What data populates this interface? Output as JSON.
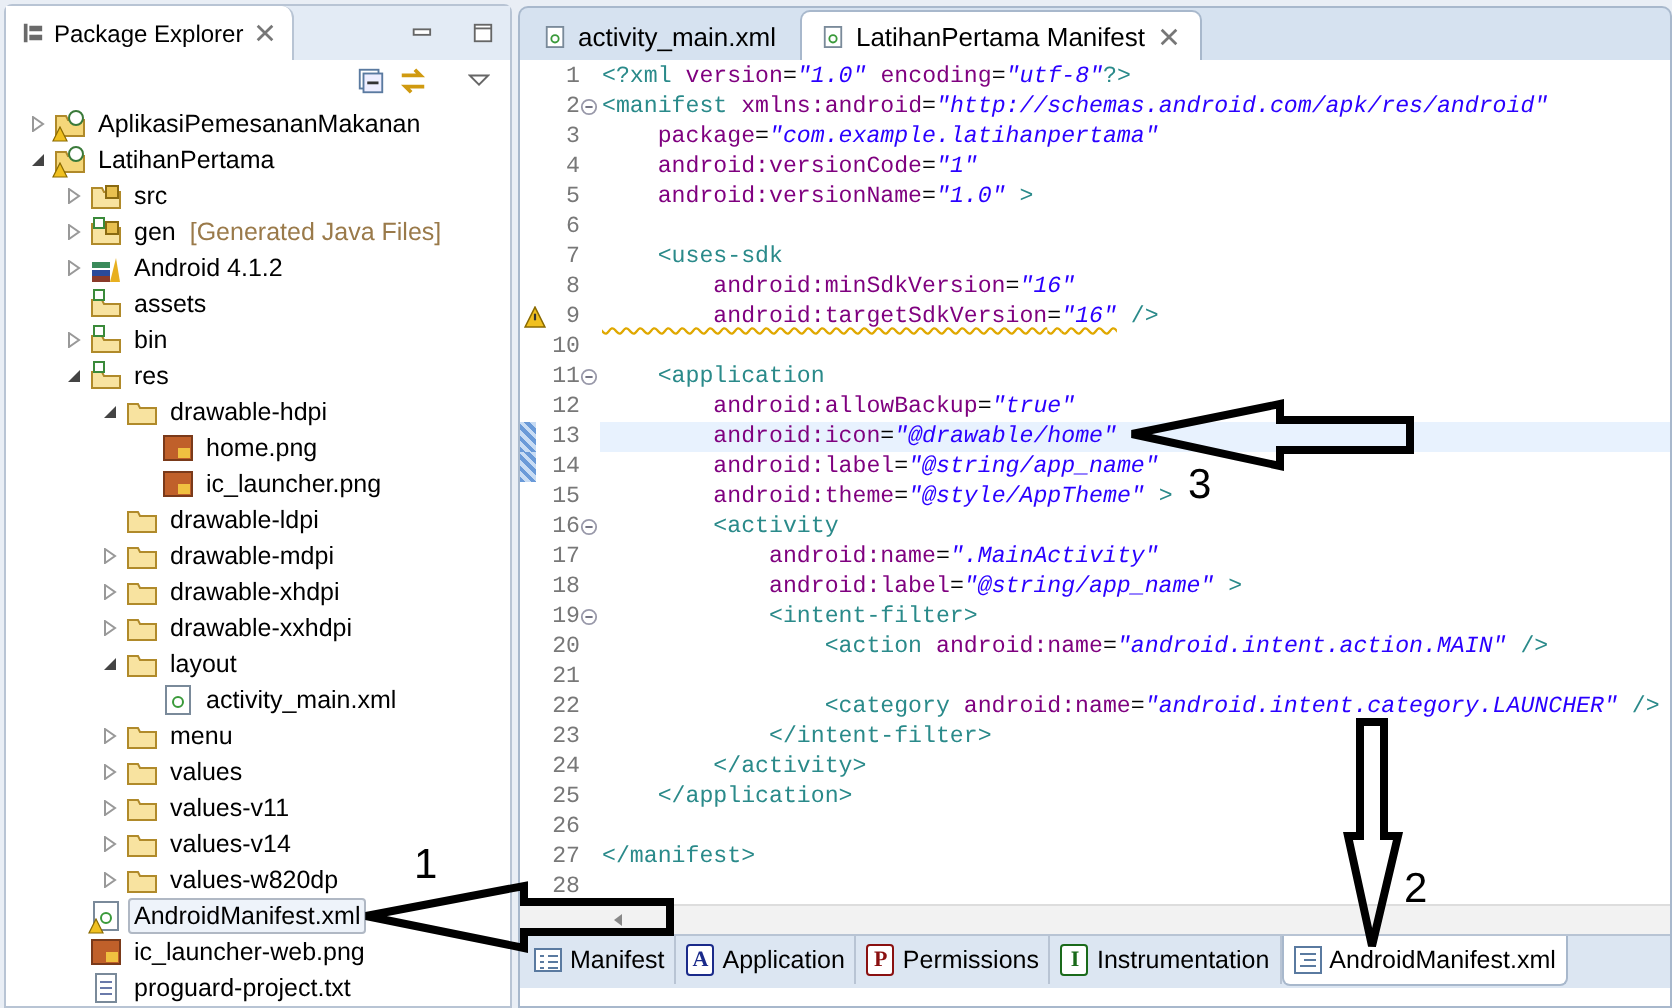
{
  "package_explorer": {
    "title": "Package Explorer",
    "tree": [
      {
        "label": "AplikasiPemesananMakanan",
        "kind": "project",
        "expanded": false,
        "warning": true,
        "selected": false
      },
      {
        "label": "LatihanPertama",
        "kind": "project",
        "expanded": true,
        "warning": true,
        "selected": false,
        "children": [
          {
            "label": "src",
            "kind": "package-folder",
            "expanded": false,
            "selected": false
          },
          {
            "label": "gen",
            "decoration": "[Generated Java Files]",
            "kind": "gen-folder",
            "expanded": false,
            "selected": false
          },
          {
            "label": "Android 4.1.2",
            "kind": "library",
            "expanded": false,
            "selected": false
          },
          {
            "label": "assets",
            "kind": "source-folder",
            "selected": false
          },
          {
            "label": "bin",
            "kind": "source-folder",
            "expanded": false,
            "selected": false
          },
          {
            "label": "res",
            "kind": "source-folder",
            "expanded": true,
            "selected": false,
            "children": [
              {
                "label": "drawable-hdpi",
                "kind": "folder",
                "expanded": true,
                "selected": false,
                "children": [
                  {
                    "label": "home.png",
                    "kind": "image",
                    "selected": false
                  },
                  {
                    "label": "ic_launcher.png",
                    "kind": "image",
                    "selected": false
                  }
                ]
              },
              {
                "label": "drawable-ldpi",
                "kind": "folder",
                "selected": false
              },
              {
                "label": "drawable-mdpi",
                "kind": "folder",
                "expanded": false,
                "selected": false
              },
              {
                "label": "drawable-xhdpi",
                "kind": "folder",
                "expanded": false,
                "selected": false
              },
              {
                "label": "drawable-xxhdpi",
                "kind": "folder",
                "expanded": false,
                "selected": false
              },
              {
                "label": "layout",
                "kind": "folder",
                "expanded": true,
                "selected": false,
                "children": [
                  {
                    "label": "activity_main.xml",
                    "kind": "xml",
                    "selected": false
                  }
                ]
              },
              {
                "label": "menu",
                "kind": "folder",
                "expanded": false,
                "selected": false
              },
              {
                "label": "values",
                "kind": "folder",
                "expanded": false,
                "selected": false
              },
              {
                "label": "values-v11",
                "kind": "folder",
                "expanded": false,
                "selected": false
              },
              {
                "label": "values-v14",
                "kind": "folder",
                "expanded": false,
                "selected": false
              },
              {
                "label": "values-w820dp",
                "kind": "folder",
                "expanded": false,
                "selected": false
              }
            ]
          },
          {
            "label": "AndroidManifest.xml",
            "kind": "xml",
            "warning": true,
            "selected": true
          },
          {
            "label": "ic_launcher-web.png",
            "kind": "image",
            "selected": false
          },
          {
            "label": "proguard-project.txt",
            "kind": "text",
            "selected": false
          }
        ]
      }
    ]
  },
  "editor": {
    "tabs": [
      {
        "label": "activity_main.xml",
        "selected": false
      },
      {
        "label": "LatihanPertama Manifest",
        "selected": true
      }
    ],
    "lines": [
      {
        "number": "1",
        "tokens": [
          {
            "kind": "tag",
            "text": "<?xml"
          },
          {
            "kind": "attr",
            "text": " version"
          },
          {
            "kind": "eq",
            "text": "="
          },
          {
            "kind": "value",
            "text": "\"1.0\""
          },
          {
            "kind": "attr",
            "text": " encoding"
          },
          {
            "kind": "eq",
            "text": "="
          },
          {
            "kind": "value",
            "text": "\"utf-8\""
          },
          {
            "kind": "tag",
            "text": "?>"
          }
        ]
      },
      {
        "number": "2",
        "fold": true,
        "tokens": [
          {
            "kind": "tag",
            "text": "<manifest"
          },
          {
            "kind": "attr",
            "text": " xmlns:android"
          },
          {
            "kind": "eq",
            "text": "="
          },
          {
            "kind": "value",
            "text": "\"http://schemas.android.com/apk/res/android\""
          }
        ]
      },
      {
        "number": "3",
        "tokens": [
          {
            "kind": "attr",
            "text": "    package"
          },
          {
            "kind": "eq",
            "text": "="
          },
          {
            "kind": "value",
            "text": "\"com.example.latihanpertama\""
          }
        ]
      },
      {
        "number": "4",
        "tokens": [
          {
            "kind": "attr",
            "text": "    android:versionCode"
          },
          {
            "kind": "eq",
            "text": "="
          },
          {
            "kind": "value",
            "text": "\"1\""
          }
        ]
      },
      {
        "number": "5",
        "tokens": [
          {
            "kind": "attr",
            "text": "    android:versionName"
          },
          {
            "kind": "eq",
            "text": "="
          },
          {
            "kind": "value",
            "text": "\"1.0\""
          },
          {
            "kind": "tag",
            "text": " >"
          }
        ]
      },
      {
        "number": "6"
      },
      {
        "number": "7",
        "tokens": [
          {
            "kind": "tag",
            "text": "    <uses-sdk"
          }
        ]
      },
      {
        "number": "8",
        "tokens": [
          {
            "kind": "attr",
            "text": "        android:minSdkVersion"
          },
          {
            "kind": "eq",
            "text": "="
          },
          {
            "kind": "value",
            "text": "\"16\""
          }
        ]
      },
      {
        "number": "9",
        "warning": true,
        "tokens": [
          {
            "kind": "attr",
            "text": "        android:targetSdkVersion",
            "squiggle": true
          },
          {
            "kind": "eq",
            "text": "=",
            "squiggle": true
          },
          {
            "kind": "value",
            "text": "\"16\"",
            "squiggle": true
          },
          {
            "kind": "tag",
            "text": " />"
          }
        ]
      },
      {
        "number": "10"
      },
      {
        "number": "11",
        "fold": true,
        "tokens": [
          {
            "kind": "tag",
            "text": "    <application"
          }
        ]
      },
      {
        "number": "12",
        "tokens": [
          {
            "kind": "attr",
            "text": "        android:allowBackup"
          },
          {
            "kind": "eq",
            "text": "="
          },
          {
            "kind": "value",
            "text": "\"true\""
          }
        ]
      },
      {
        "number": "13",
        "current": true,
        "changed": true,
        "tokens": [
          {
            "kind": "attr",
            "text": "        android:icon"
          },
          {
            "kind": "eq",
            "text": "="
          },
          {
            "kind": "value",
            "text": "\"@drawable/home\""
          }
        ]
      },
      {
        "number": "14",
        "changed": true,
        "tokens": [
          {
            "kind": "attr",
            "text": "        android:label"
          },
          {
            "kind": "eq",
            "text": "="
          },
          {
            "kind": "value",
            "text": "\"@string/app_name\""
          }
        ]
      },
      {
        "number": "15",
        "tokens": [
          {
            "kind": "attr",
            "text": "        android:theme"
          },
          {
            "kind": "eq",
            "text": "="
          },
          {
            "kind": "value",
            "text": "\"@style/AppTheme\""
          },
          {
            "kind": "tag",
            "text": " >"
          }
        ]
      },
      {
        "number": "16",
        "fold": true,
        "tokens": [
          {
            "kind": "tag",
            "text": "        <activity"
          }
        ]
      },
      {
        "number": "17",
        "tokens": [
          {
            "kind": "attr",
            "text": "            android:name"
          },
          {
            "kind": "eq",
            "text": "="
          },
          {
            "kind": "value",
            "text": "\".MainActivity\""
          }
        ]
      },
      {
        "number": "18",
        "tokens": [
          {
            "kind": "attr",
            "text": "            android:label"
          },
          {
            "kind": "eq",
            "text": "="
          },
          {
            "kind": "value",
            "text": "\"@string/app_name\""
          },
          {
            "kind": "tag",
            "text": " >"
          }
        ]
      },
      {
        "number": "19",
        "fold": true,
        "tokens": [
          {
            "kind": "tag",
            "text": "            <intent-filter>"
          }
        ]
      },
      {
        "number": "20",
        "tokens": [
          {
            "kind": "tag",
            "text": "                <action"
          },
          {
            "kind": "attr",
            "text": " android:name"
          },
          {
            "kind": "eq",
            "text": "="
          },
          {
            "kind": "value",
            "text": "\"android.intent.action.MAIN\""
          },
          {
            "kind": "tag",
            "text": " />"
          }
        ]
      },
      {
        "number": "21"
      },
      {
        "number": "22",
        "tokens": [
          {
            "kind": "tag",
            "text": "                <category"
          },
          {
            "kind": "attr",
            "text": " android:name"
          },
          {
            "kind": "eq",
            "text": "="
          },
          {
            "kind": "value",
            "text": "\"android.intent.category.LAUNCHER\""
          },
          {
            "kind": "tag",
            "text": " />"
          }
        ]
      },
      {
        "number": "23",
        "tokens": [
          {
            "kind": "tag",
            "text": "            </intent-filter>"
          }
        ]
      },
      {
        "number": "24",
        "tokens": [
          {
            "kind": "tag",
            "text": "        </activity>"
          }
        ]
      },
      {
        "number": "25",
        "tokens": [
          {
            "kind": "tag",
            "text": "    </application>"
          }
        ]
      },
      {
        "number": "26"
      },
      {
        "number": "27",
        "tokens": [
          {
            "kind": "tag",
            "text": "</manifest>"
          }
        ]
      },
      {
        "number": "28"
      }
    ],
    "bottom_tabs": [
      {
        "label": "Manifest",
        "kind": "form",
        "selected": false
      },
      {
        "label": "Application",
        "kind": "letter",
        "letter": "A",
        "color": "#1a2a8a",
        "selected": false
      },
      {
        "label": "Permissions",
        "kind": "letter",
        "letter": "P",
        "color": "#8a1010",
        "selected": false
      },
      {
        "label": "Instrumentation",
        "kind": "letter",
        "letter": "I",
        "color": "#1a6a1a",
        "selected": false
      },
      {
        "label": "AndroidManifest.xml",
        "kind": "source",
        "selected": true
      }
    ]
  },
  "annotations": [
    {
      "label": "1"
    },
    {
      "label": "2"
    },
    {
      "label": "3"
    }
  ]
}
